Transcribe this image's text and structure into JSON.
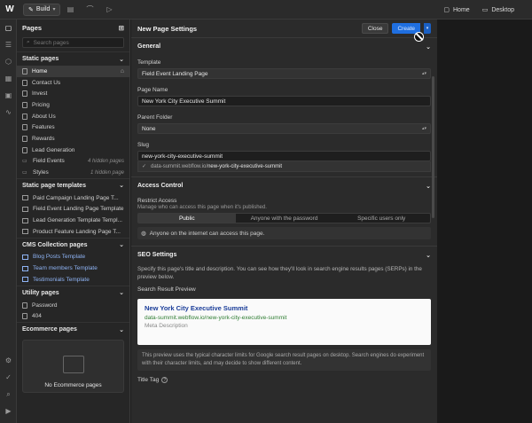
{
  "topbar": {
    "mode": "Build",
    "page": "Home",
    "breakpoint": "Desktop"
  },
  "pages_panel": {
    "title": "Pages",
    "search_placeholder": "Search pages",
    "static": {
      "title": "Static pages",
      "items": [
        {
          "label": "Home",
          "meta": ""
        },
        {
          "label": "Contact Us",
          "meta": ""
        },
        {
          "label": "Invest",
          "meta": ""
        },
        {
          "label": "Pricing",
          "meta": ""
        },
        {
          "label": "About Us",
          "meta": ""
        },
        {
          "label": "Features",
          "meta": ""
        },
        {
          "label": "Rewards",
          "meta": ""
        },
        {
          "label": "Lead Generation",
          "meta": ""
        },
        {
          "label": "Field Events",
          "meta": "4 hidden pages"
        },
        {
          "label": "Styles",
          "meta": "1 hidden page"
        }
      ]
    },
    "templates": {
      "title": "Static page templates",
      "items": [
        "Paid Campaign Landing Page T...",
        "Field Event Landing Page Template",
        "Lead Generation Template Templ...",
        "Product Feature Landing Page T..."
      ]
    },
    "cms": {
      "title": "CMS Collection pages",
      "items": [
        "Blog Posts Template",
        "Team members Template",
        "Testimonials Template"
      ]
    },
    "utility": {
      "title": "Utility pages",
      "items": [
        "Password",
        "404"
      ]
    },
    "ecommerce": {
      "title": "Ecommerce pages",
      "empty": "No Ecommerce pages"
    }
  },
  "settings": {
    "title": "New Page Settings",
    "close": "Close",
    "create": "Create",
    "general": {
      "title": "General",
      "template_label": "Template",
      "template_value": "Field Event Landing Page",
      "name_label": "Page Name",
      "name_value": "New York City Executive Summit",
      "folder_label": "Parent Folder",
      "folder_value": "None",
      "slug_label": "Slug",
      "slug_value": "new-york-city-executive-summit",
      "slug_domain": "data-summit.webflow.io/",
      "slug_path": "new-york-city-executive-summit"
    },
    "access": {
      "title": "Access Control",
      "restrict_label": "Restrict Access",
      "restrict_sub": "Manage who can access this page when it's published.",
      "options": [
        "Public",
        "Anyone with the password",
        "Specific users only"
      ],
      "note": "Anyone on the internet can access this page."
    },
    "seo": {
      "title": "SEO Settings",
      "desc": "Specify this page's title and description. You can see how they'll look in search engine results pages (SERPs) in the preview below.",
      "preview_label": "Search Result Preview",
      "preview_title": "New York City Executive Summit",
      "preview_url": "data-summit.webflow.io/new-york-city-executive-summit",
      "preview_desc": "Meta Description",
      "note": "This preview uses the typical character limits for Google search result pages on desktop. Search engines do experiment with their character limits, and may decide to show different content.",
      "title_tag_label": "Title Tag"
    }
  }
}
